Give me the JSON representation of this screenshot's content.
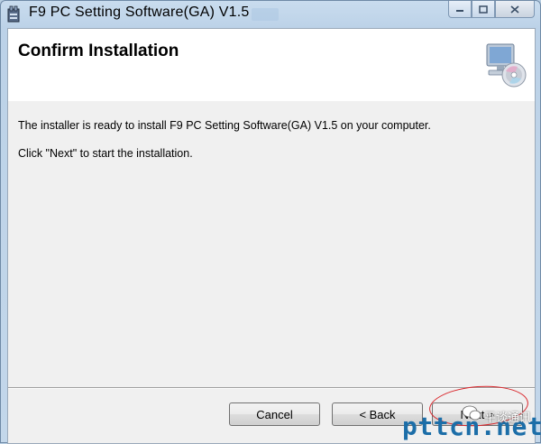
{
  "window": {
    "title": "F9 PC Setting Software(GA) V1.5",
    "app_icon": "installer-icon",
    "controls": {
      "minimize_icon": "minimize-icon",
      "maximize_icon": "maximize-icon",
      "close_icon": "close-icon"
    }
  },
  "banner": {
    "title": "Confirm Installation",
    "icon": "computer-disc-icon"
  },
  "body": {
    "line1": "The installer is ready to install F9 PC Setting Software(GA) V1.5 on your computer.",
    "line2": "Click \"Next\" to start the installation."
  },
  "buttons": {
    "cancel": "Cancel",
    "back": "< Back",
    "next": "Next >"
  },
  "annotation": {
    "highlight_color": "#d9262b"
  },
  "watermark": {
    "site": "pttcn.net",
    "tag": "平谈通讯"
  },
  "colors": {
    "watermark": "#1c6ea8"
  }
}
